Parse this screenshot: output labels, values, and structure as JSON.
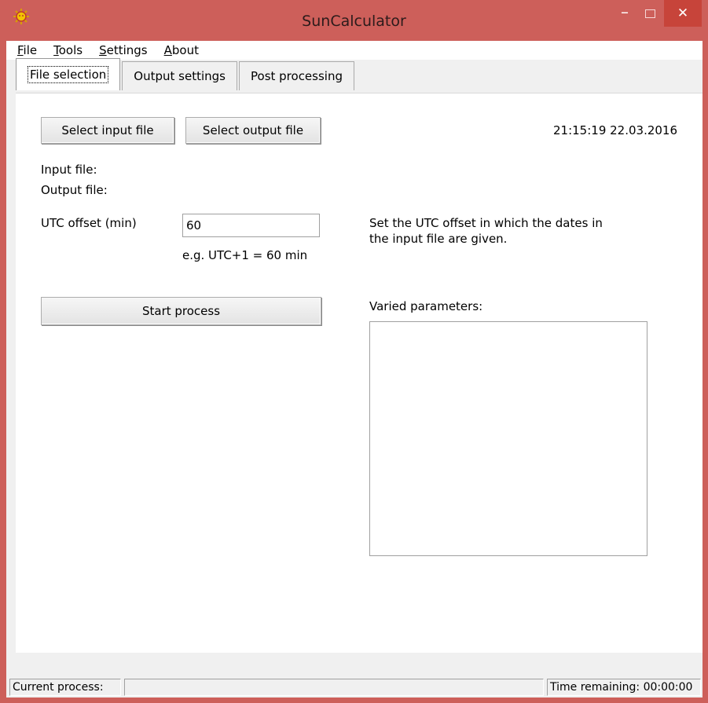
{
  "window": {
    "title": "SunCalculator",
    "minimize_glyph": "–",
    "close_glyph": "✕",
    "icon": "sun-icon"
  },
  "menu": [
    {
      "label": "File",
      "mnemonic": "F",
      "rest": "ile"
    },
    {
      "label": "Tools",
      "mnemonic": "T",
      "rest": "ools"
    },
    {
      "label": "Settings",
      "mnemonic": "S",
      "rest": "ettings"
    },
    {
      "label": "About",
      "mnemonic": "A",
      "rest": "bout"
    }
  ],
  "tabs": [
    {
      "label": "File selection",
      "active": true
    },
    {
      "label": "Output settings",
      "active": false
    },
    {
      "label": "Post processing",
      "active": false
    }
  ],
  "panel": {
    "select_input_label": "Select input file",
    "select_output_label": "Select output file",
    "datetime": "21:15:19 22.03.2016",
    "input_file_label": "Input file:",
    "output_file_label": "Output file:",
    "utc_offset_label": "UTC offset (min)",
    "utc_offset_value": "60",
    "utc_example": "e.g. UTC+1 = 60 min",
    "utc_help_line1": "Set the UTC offset in which the dates in",
    "utc_help_line2": "the input file are given.",
    "start_label": "Start process",
    "varied_label": "Varied parameters:"
  },
  "status": {
    "current_label": "Current process:",
    "current_value": "",
    "time_remaining": "Time remaining: 00:00:00"
  },
  "colors": {
    "titlebar": "#cd5f5a",
    "close_button": "#c7443a"
  }
}
